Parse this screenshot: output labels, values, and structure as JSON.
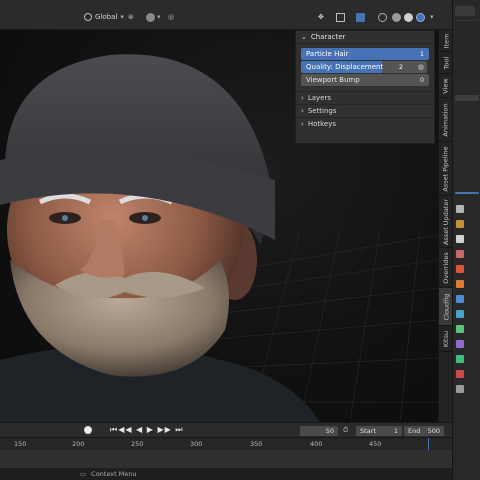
{
  "header": {
    "orientation": "Global"
  },
  "npanel": {
    "title": "Character",
    "rows": [
      {
        "label": "Particle Hair",
        "value": "1"
      },
      {
        "label": "Quality: Displacement",
        "value": "2"
      },
      {
        "label": "Viewport Bump",
        "value": "0"
      }
    ],
    "sections": [
      "Layers",
      "Settings",
      "Hotkeys"
    ]
  },
  "tabs": [
    "Item",
    "Tool",
    "View",
    "Animation",
    "Asset Pipeline",
    "Asset Updater",
    "Overrides",
    "Cloudfig",
    "KItsu"
  ],
  "timeline": {
    "current_frame": "50",
    "start_label": "Start",
    "start": "1",
    "end_label": "End",
    "end": "500"
  },
  "ruler": [
    "150",
    "200",
    "250",
    "300",
    "350",
    "400",
    "450"
  ],
  "status": {
    "context_menu": "Context Menu"
  }
}
